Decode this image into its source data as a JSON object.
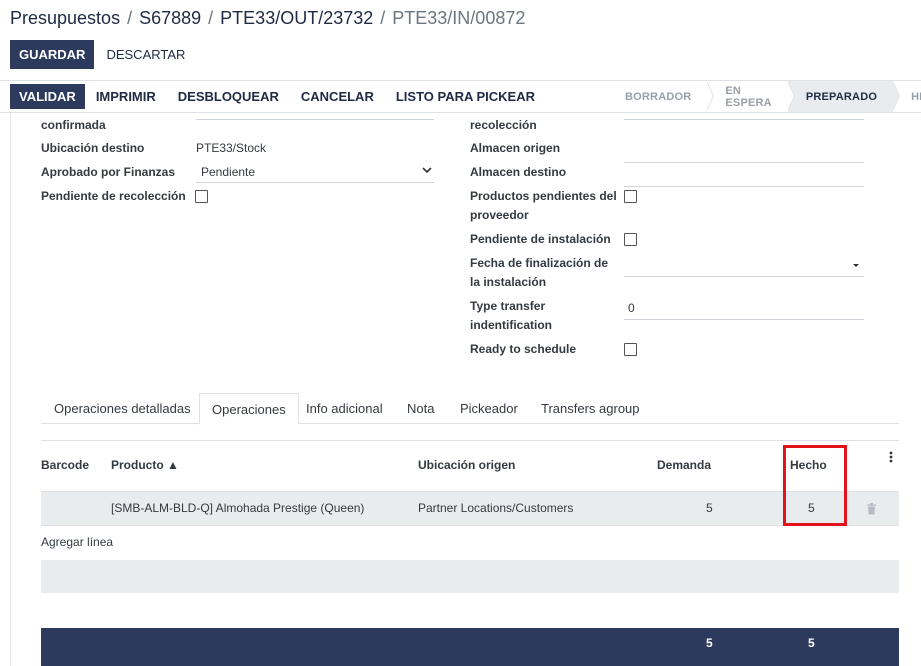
{
  "breadcrumb": [
    "Presupuestos",
    "S67889",
    "PTE33/OUT/23732",
    "PTE33/IN/00872"
  ],
  "buttons": {
    "save": "GUARDAR",
    "discard": "DESCARTAR"
  },
  "actions": [
    "VALIDAR",
    "IMPRIMIR",
    "DESBLOQUEAR",
    "CANCELAR",
    "LISTO PARA PICKEAR"
  ],
  "stages": [
    "BORRADOR",
    "EN ESPERA",
    "PREPARADO",
    "HECHO"
  ],
  "stage_visible": [
    "BORRADOR",
    "EN ESPERA",
    "PREPARADO",
    "HECH"
  ],
  "left_fields": {
    "confirmada": "confirmada",
    "ubicacion_label": "Ubicación destino",
    "ubicacion_value": "PTE33/Stock",
    "aprobado_label": "Aprobado por Finanzas",
    "aprobado_value": "Pendiente",
    "pendiente_recoleccion_label": "Pendiente de recolección"
  },
  "right_fields": {
    "recoleccion": "recolección",
    "almacen_origen": "Almacen origen",
    "almacen_destino": "Almacen destino",
    "productos_pendientes_1": "Productos pendientes del",
    "productos_pendientes_2": "proveedor",
    "pendiente_instalacion": "Pendiente de instalación",
    "fecha_fin_1": "Fecha de finalización de",
    "fecha_fin_2": "la instalación",
    "type_transfer_1": "Type transfer",
    "type_transfer_2": "indentification",
    "type_transfer_value": "0",
    "ready_to_schedule": "Ready to schedule"
  },
  "tabs": [
    "Operaciones detalladas",
    "Operaciones",
    "Info adicional",
    "Nota",
    "Pickeador",
    "Transfers agroup"
  ],
  "table": {
    "headers": {
      "barcode": "Barcode",
      "producto": "Producto ▲",
      "ubicacion": "Ubicación origen",
      "demanda": "Demanda",
      "hecho": "Hecho"
    },
    "rows": [
      {
        "barcode": "",
        "producto": "[SMB-ALM-BLD-Q] Almohada Prestige (Queen)",
        "ubicacion": "Partner Locations/Customers",
        "demanda": "5",
        "hecho": "5"
      }
    ],
    "add_line": "Agregar línea",
    "totals": {
      "demanda": "5",
      "hecho": "5"
    }
  },
  "colors": {
    "primary": "#2c3a5e",
    "highlight": "#e2131a"
  }
}
